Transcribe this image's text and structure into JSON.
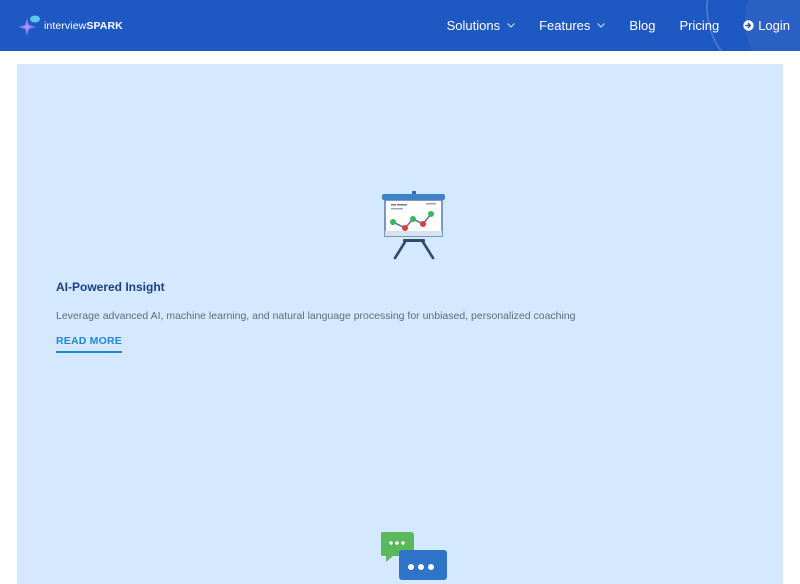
{
  "header": {
    "logo": {
      "light": "interview",
      "bold": "SPARK",
      "icon": "spark-logo-icon"
    },
    "nav": [
      {
        "label": "Solutions",
        "has_dropdown": true
      },
      {
        "label": "Features",
        "has_dropdown": true
      },
      {
        "label": "Blog",
        "has_dropdown": false
      },
      {
        "label": "Pricing",
        "has_dropdown": false
      },
      {
        "label": "Login",
        "icon": "login-icon"
      }
    ]
  },
  "features": [
    {
      "icon": "presentation-chart-icon",
      "title": "AI-Powered Insight",
      "description": "Leverage advanced AI, machine learning, and natural language processing for unbiased, personalized coaching",
      "link_label": "READ MORE"
    },
    {
      "icon": "chat-bubbles-icon"
    }
  ],
  "colors": {
    "navbar": "#1e58c2",
    "card_bg": "#d4e9ff",
    "title": "#1c3f87",
    "link": "#1e88d6"
  }
}
